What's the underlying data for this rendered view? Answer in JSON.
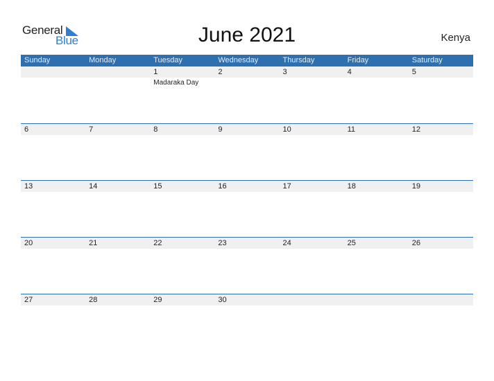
{
  "logo": {
    "part1": "General",
    "part2": "Blue"
  },
  "header": {
    "title": "June 2021",
    "country": "Kenya"
  },
  "weekdays": [
    "Sunday",
    "Monday",
    "Tuesday",
    "Wednesday",
    "Thursday",
    "Friday",
    "Saturday"
  ],
  "weeks": [
    {
      "days": [
        "",
        "",
        "1",
        "2",
        "3",
        "4",
        "5"
      ],
      "events": [
        "",
        "",
        "Madaraka Day",
        "",
        "",
        "",
        ""
      ]
    },
    {
      "days": [
        "6",
        "7",
        "8",
        "9",
        "10",
        "11",
        "12"
      ],
      "events": [
        "",
        "",
        "",
        "",
        "",
        "",
        ""
      ]
    },
    {
      "days": [
        "13",
        "14",
        "15",
        "16",
        "17",
        "18",
        "19"
      ],
      "events": [
        "",
        "",
        "",
        "",
        "",
        "",
        ""
      ]
    },
    {
      "days": [
        "20",
        "21",
        "22",
        "23",
        "24",
        "25",
        "26"
      ],
      "events": [
        "",
        "",
        "",
        "",
        "",
        "",
        ""
      ]
    },
    {
      "days": [
        "27",
        "28",
        "29",
        "30",
        "",
        "",
        ""
      ],
      "events": [
        "",
        "",
        "",
        "",
        "",
        "",
        ""
      ]
    }
  ],
  "colors": {
    "header_bg": "#2e6faf",
    "brand_blue": "#2e7fd0",
    "date_strip": "#f0f0f0"
  }
}
